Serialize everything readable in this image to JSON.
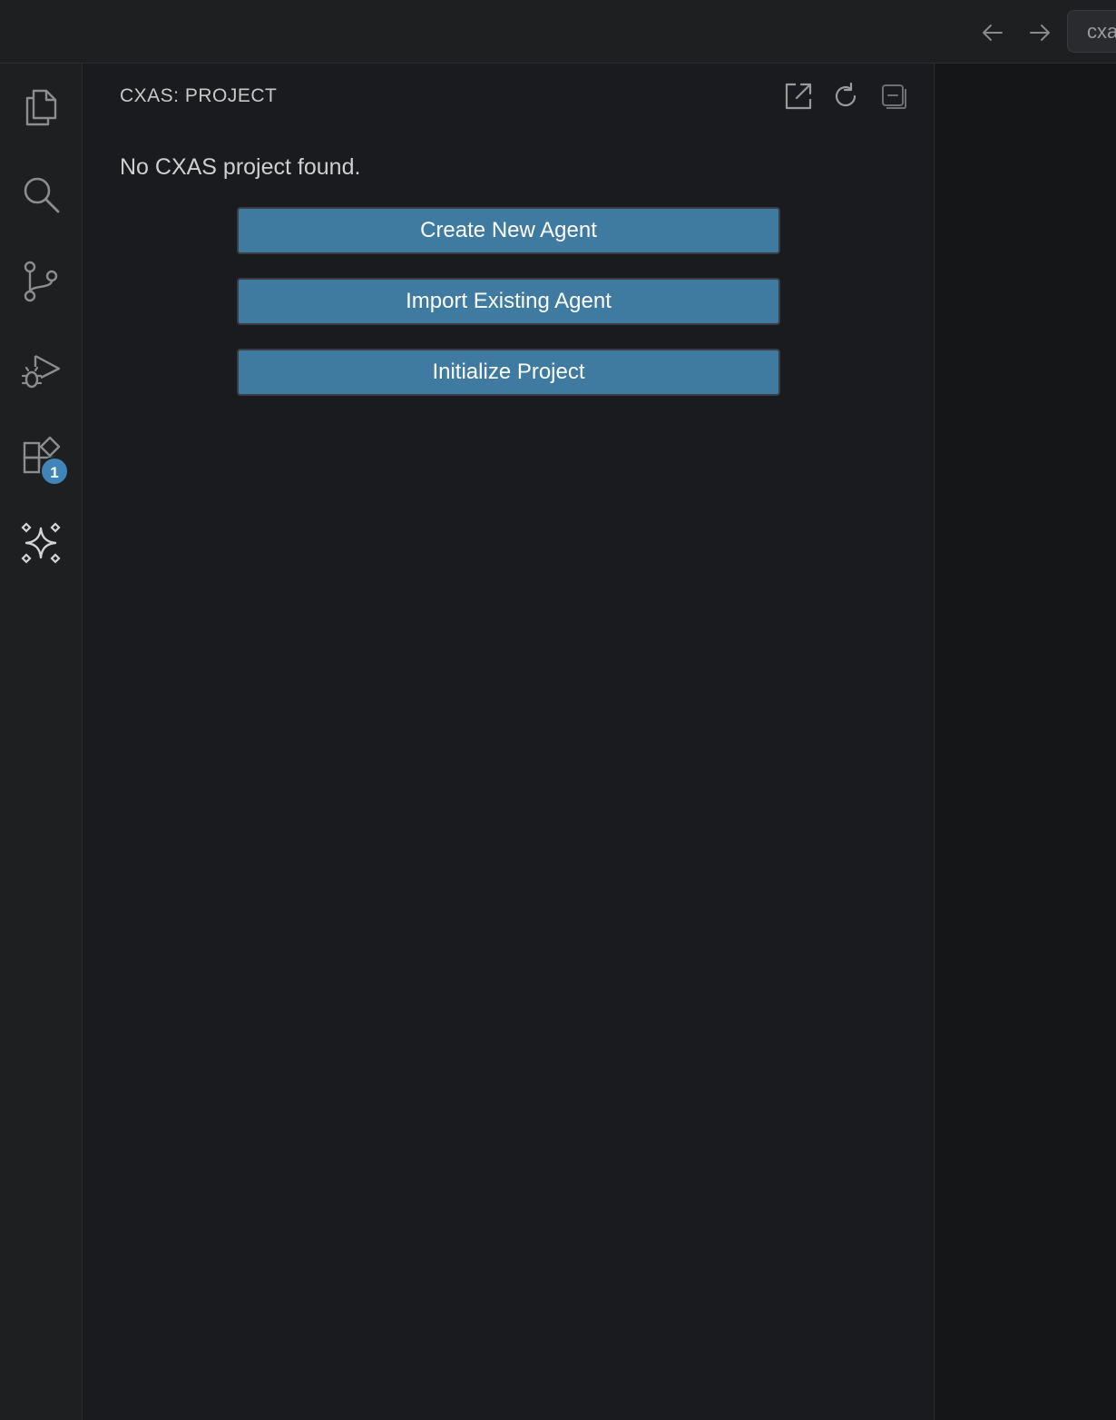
{
  "titlebar": {
    "command_center_text": "cxa",
    "icons": [
      "arrow-left-icon",
      "arrow-right-icon"
    ]
  },
  "activitybar": {
    "items": [
      {
        "id": "explorer",
        "icon": "files-icon"
      },
      {
        "id": "search",
        "icon": "search-icon"
      },
      {
        "id": "source-control",
        "icon": "source-control-icon"
      },
      {
        "id": "run-debug",
        "icon": "run-debug-icon"
      },
      {
        "id": "extensions",
        "icon": "extensions-icon",
        "badge": "1"
      },
      {
        "id": "cxas",
        "icon": "sparkle-diamond-icon"
      }
    ],
    "extensions_badge": "1"
  },
  "sidebar": {
    "title": "CXAS: PROJECT",
    "actions": [
      "open-external-icon",
      "refresh-icon",
      "collapse-all-icon"
    ],
    "message": "No CXAS project found.",
    "buttons": {
      "create": "Create New Agent",
      "import": "Import Existing Agent",
      "initialize": "Initialize Project"
    }
  },
  "colors": {
    "accent_button": "#3f7aa1",
    "badge": "#3f85b8",
    "background": "#1a1b1e"
  }
}
